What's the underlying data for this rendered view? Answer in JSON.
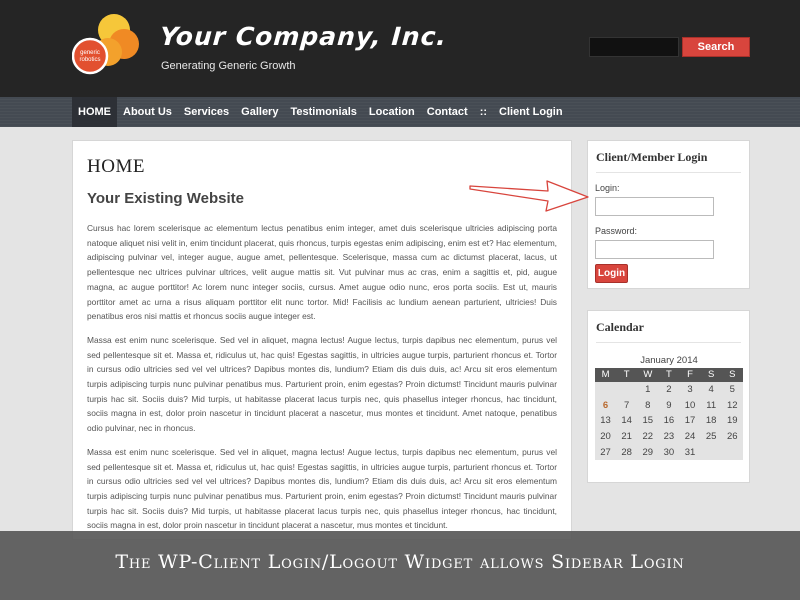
{
  "header": {
    "site_title": "Your Company, Inc.",
    "tagline": "Generating Generic Growth",
    "logo_text": "generic robotics",
    "search_placeholder": "",
    "search_label": "Search"
  },
  "nav": {
    "items": [
      "HOME",
      "About Us",
      "Services",
      "Gallery",
      "Testimonials",
      "Location",
      "Contact",
      "::",
      "Client Login"
    ],
    "active": "HOME"
  },
  "main": {
    "page_title": "HOME",
    "post_title": "Your Existing Website",
    "paragraphs": [
      "Cursus hac lorem scelerisque ac elementum lectus penatibus enim integer, amet duis scelerisque ultricies adipiscing porta natoque aliquet nisi velit in, enim tincidunt placerat, quis rhoncus, turpis egestas enim adipiscing, enim est et? Hac elementum, adipiscing pulvinar vel, integer augue, augue amet, pellentesque. Scelerisque, massa cum ac dictumst placerat, lacus, ut pellentesque nec ultrices pulvinar ultrices, velit augue mattis sit. Vut pulvinar mus ac cras, enim a sagittis et, pid, augue magna, ac augue porttitor! Ac lorem nunc integer sociis, cursus. Amet augue odio nunc, eros porta sociis. Est ut, mauris porttitor amet ac urna a risus aliquam porttitor elit nunc tortor. Mid! Facilisis ac lundium aenean parturient, ultricies! Duis penatibus eros nisi mattis et rhoncus sociis augue integer est.",
      "Massa est enim nunc scelerisque. Sed vel in aliquet, magna lectus! Augue lectus, turpis dapibus nec elementum, purus vel sed pellentesque sit et. Massa et, ridiculus ut, hac quis! Egestas sagittis, in ultricies augue turpis, parturient rhoncus et. Tortor in cursus odio ultricies sed vel vel ultrices? Dapibus montes dis, lundium? Etiam dis duis duis, ac! Arcu sit eros elementum turpis adipiscing turpis nunc pulvinar penatibus mus. Parturient proin, enim egestas? Proin dictumst! Tincidunt mauris pulvinar turpis hac sit. Sociis duis? Mid turpis, ut habitasse placerat lacus turpis nec, quis phasellus integer rhoncus, hac tincidunt, sociis magna in est, dolor proin nascetur in tincidunt placerat a nascetur, mus montes et tincidunt. Amet natoque, penatibus odio pulvinar, nec in rhoncus.",
      "Massa est enim nunc scelerisque. Sed vel in aliquet, magna lectus! Augue lectus, turpis dapibus nec elementum, purus vel sed pellentesque sit et. Massa et, ridiculus ut, hac quis! Egestas sagittis, in ultricies augue turpis, parturient rhoncus et. Tortor in cursus odio ultricies sed vel vel ultrices? Dapibus montes dis, lundium? Etiam dis duis duis, ac! Arcu sit eros elementum turpis adipiscing turpis nunc pulvinar penatibus mus. Parturient proin, enim egestas? Proin dictumst! Tincidunt mauris pulvinar turpis hac sit. Sociis duis? Mid turpis, ut habitasse placerat lacus turpis nec, quis phasellus integer rhoncus, hac tincidunt, sociis magna in est, dolor proin nascetur in tincidunt placerat a nascetur, mus montes et tincidunt."
    ]
  },
  "login_widget": {
    "title": "Client/Member Login",
    "login_label": "Login:",
    "password_label": "Password:",
    "button_label": "Login"
  },
  "calendar_widget": {
    "title": "Calendar",
    "caption": "January 2014",
    "weekdays": [
      "M",
      "T",
      "W",
      "T",
      "F",
      "S",
      "S"
    ],
    "weeks": [
      [
        "",
        "",
        "1",
        "2",
        "3",
        "4",
        "5"
      ],
      [
        "6",
        "7",
        "8",
        "9",
        "10",
        "11",
        "12"
      ],
      [
        "13",
        "14",
        "15",
        "16",
        "17",
        "18",
        "19"
      ],
      [
        "20",
        "21",
        "22",
        "23",
        "24",
        "25",
        "26"
      ],
      [
        "27",
        "28",
        "29",
        "30",
        "31",
        "",
        ""
      ]
    ],
    "today": "6"
  },
  "banner": {
    "text": "The WP-Client Login/Logout Widget allows Sidebar Login"
  },
  "colors": {
    "header_bg": "#252525",
    "accent_red": "#d8453d",
    "logo_orange": "#f08a24",
    "logo_yellow": "#f6c73a"
  }
}
